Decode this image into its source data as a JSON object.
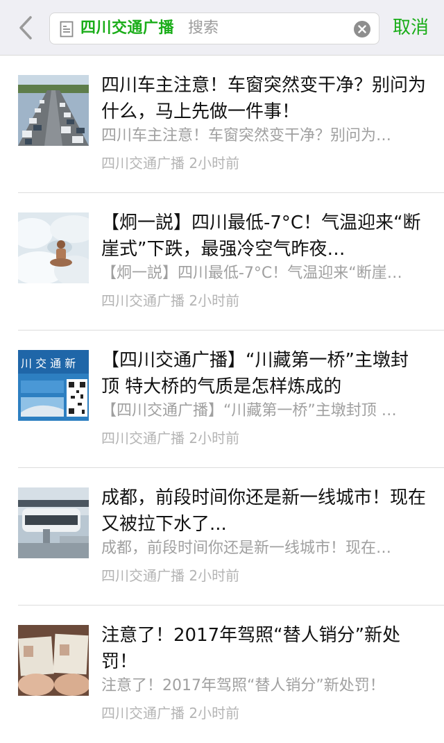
{
  "header": {
    "search_tag": "四川交通广播",
    "search_placeholder": "搜索",
    "cancel_label": "取消",
    "accent_color": "#1aad19"
  },
  "thumb_text": {
    "item3_banner": "川 交 通 新"
  },
  "articles": [
    {
      "title": "四川车主注意！车窗突然变干净？别问为什么，马上先做一件事！",
      "summary": "四川车主注意！车窗突然变干净？别问为…",
      "source": "四川交通广播",
      "time": "2小时前",
      "thumb_icon": "traffic-photo"
    },
    {
      "title": "【炯一説】四川最低-7°C！气温迎来“断崖式”下跌，最强冷空气昨夜…",
      "summary": "【炯一説】四川最低-7°C！气温迎来“断崖…",
      "source": "四川交通广播",
      "time": "2小时前",
      "thumb_icon": "snow-man-photo"
    },
    {
      "title": "【四川交通广播】“川藏第一桥”主墩封顶 特大桥的气质是怎样炼成的",
      "summary": "【四川交通广播】“川藏第一桥”主墩封顶 …",
      "source": "四川交通广播",
      "time": "2小时前",
      "thumb_icon": "qr-banner-image"
    },
    {
      "title": "成都，前段时间你还是新一线城市！现在又被拉下水了...",
      "summary": "成都，前段时间你还是新一线城市！现在…",
      "source": "四川交通广播",
      "time": "2小时前",
      "thumb_icon": "monorail-photo"
    },
    {
      "title": "注意了！2017年驾照“替人销分”新处罚！",
      "summary": "注意了！2017年驾照“替人销分”新处罚！",
      "source": "四川交通广播",
      "time": "2小时前",
      "thumb_icon": "license-photo"
    }
  ]
}
